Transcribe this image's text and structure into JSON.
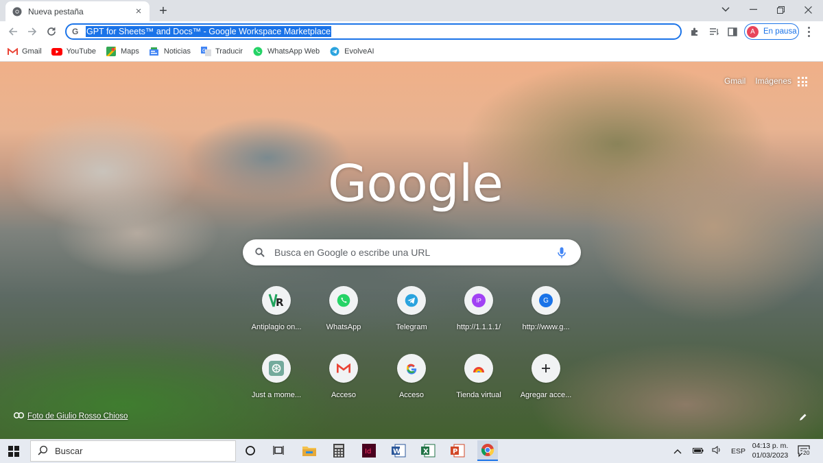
{
  "tab": {
    "title": "Nueva pestaña",
    "favicon": "chrome-icon"
  },
  "window": {
    "minimize_icon": "chevron-down-icon",
    "controls": [
      "minimize-icon",
      "restore-icon",
      "close-icon"
    ]
  },
  "omnibox": {
    "prefix": "G",
    "url_selected": "GPT for Sheets™ and Docs™ - Google Workspace Marketplace"
  },
  "profile": {
    "initial": "A",
    "label": "En pausa",
    "color": "#e8445a"
  },
  "bookmarks": [
    {
      "label": "Gmail",
      "icon": "gmail-icon"
    },
    {
      "label": "YouTube",
      "icon": "youtube-icon"
    },
    {
      "label": "Maps",
      "icon": "maps-icon"
    },
    {
      "label": "Noticias",
      "icon": "news-icon"
    },
    {
      "label": "Traducir",
      "icon": "translate-icon"
    },
    {
      "label": "WhatsApp Web",
      "icon": "whatsapp-icon"
    },
    {
      "label": "EvolveAI",
      "icon": "telegram-icon"
    }
  ],
  "ntp": {
    "gmail_link": "Gmail",
    "images_link": "Imágenes",
    "logo": "Google",
    "search_placeholder": "Busca en Google o escribe una URL",
    "shortcuts_row1": [
      {
        "label": "Antiplagio on...",
        "icon": "antiplagio-icon"
      },
      {
        "label": "WhatsApp",
        "icon": "whatsapp-icon"
      },
      {
        "label": "Telegram",
        "icon": "telegram-icon"
      },
      {
        "label": "http://1.1.1.1/",
        "icon": "ip-icon",
        "badge": "IP"
      },
      {
        "label": "http://www.g...",
        "icon": "g-letter-icon",
        "badge": "G"
      }
    ],
    "shortcuts_row2": [
      {
        "label": "Just a mome...",
        "icon": "chatgpt-icon"
      },
      {
        "label": "Acceso",
        "icon": "gmail-icon"
      },
      {
        "label": "Acceso",
        "icon": "google-icon"
      },
      {
        "label": "Tienda virtual",
        "icon": "store-icon"
      },
      {
        "label": "Agregar acce...",
        "icon": "plus-icon"
      }
    ],
    "attribution": "Foto de Giulio Rosso Chioso"
  },
  "taskbar": {
    "search_label": "Buscar",
    "language": "ESP",
    "time": "04:13 p. m.",
    "date": "01/03/2023",
    "notifications": "20"
  },
  "colors": {
    "accent": "#1a73e8",
    "tabstrip": "#dee1e6",
    "taskbar": "#e6eaf1"
  }
}
